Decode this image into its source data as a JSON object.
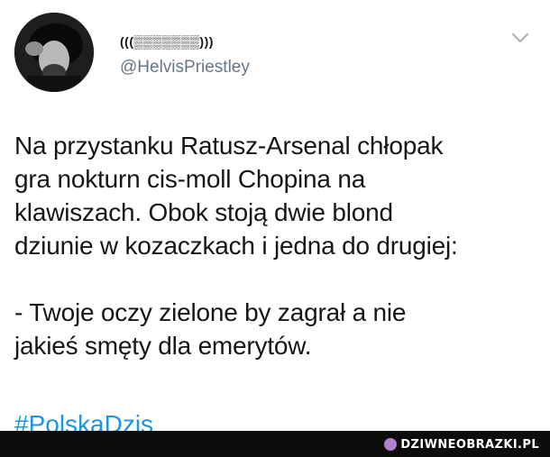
{
  "tweet": {
    "display_name": "(((▒▒▒▒▒▒▒)))",
    "handle": "@HelvisPriestley",
    "lines": [
      "Na przystanku Ratusz-Arsenal chłopak",
      "gra nokturn cis-moll Chopina na",
      "klawiszach. Obok stoją dwie blond",
      "dziunie w kozaczkach i jedna do drugiej:",
      "- Twoje oczy zielone by zagrał a nie",
      "jakieś smęty dla emerytów."
    ],
    "hashtag": "#PolskaDzis"
  },
  "watermark": {
    "text": "DZIWNEOBRAZKI.PL"
  },
  "colors": {
    "text": "#14171a",
    "handle": "#657786",
    "hashtag": "#1b95e0",
    "footer": "#0d0d0d"
  }
}
